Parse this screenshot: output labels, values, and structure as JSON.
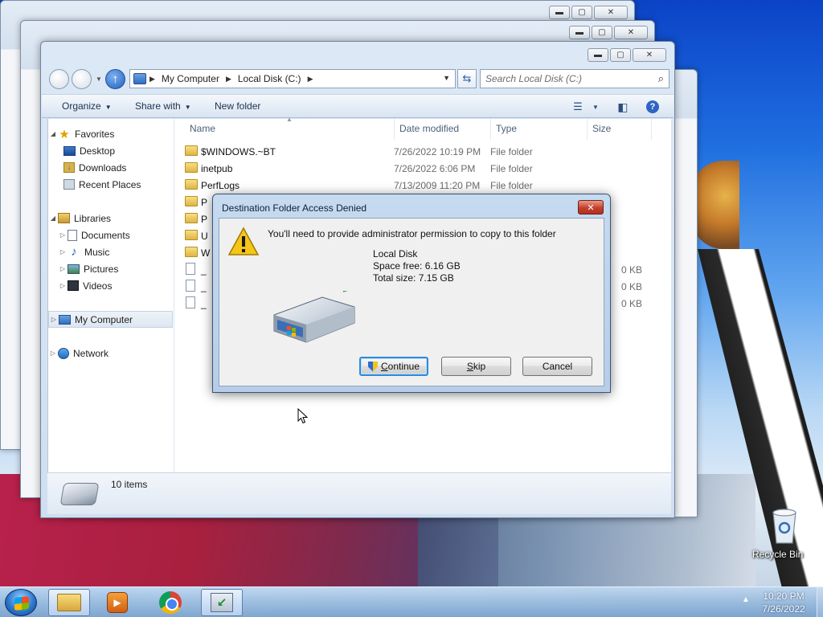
{
  "window": {
    "caption_buttons": {
      "minimize": "▬",
      "maximize": "▢",
      "close": "✕"
    },
    "address": {
      "segments": [
        "My Computer",
        "Local Disk (C:)"
      ]
    },
    "search_placeholder": "Search Local Disk (C:)",
    "toolbar": {
      "organize": "Organize",
      "share_with": "Share with",
      "new_folder": "New folder"
    },
    "nav": {
      "favorites": "Favorites",
      "desktop": "Desktop",
      "downloads": "Downloads",
      "recent_places": "Recent Places",
      "libraries": "Libraries",
      "documents": "Documents",
      "music": "Music",
      "pictures": "Pictures",
      "videos": "Videos",
      "my_computer": "My Computer",
      "network": "Network"
    },
    "columns": {
      "name": "Name",
      "date_modified": "Date modified",
      "type": "Type",
      "size": "Size"
    },
    "files": [
      {
        "name": "$WINDOWS.~BT",
        "date": "7/26/2022 10:19 PM",
        "type": "File folder",
        "size": ""
      },
      {
        "name": "inetpub",
        "date": "7/26/2022 6:06 PM",
        "type": "File folder",
        "size": ""
      },
      {
        "name": "PerfLogs",
        "date": "7/13/2009 11:20 PM",
        "type": "File folder",
        "size": ""
      },
      {
        "name": "P",
        "date": "",
        "type": "",
        "size": ""
      },
      {
        "name": "P",
        "date": "",
        "type": "",
        "size": ""
      },
      {
        "name": "U",
        "date": "",
        "type": "",
        "size": ""
      },
      {
        "name": "W",
        "date": "",
        "type": "",
        "size": ""
      },
      {
        "name": "_",
        "date": "",
        "type": "",
        "size": "0 KB"
      },
      {
        "name": "_",
        "date": "",
        "type": "",
        "size": "0 KB"
      },
      {
        "name": "_",
        "date": "",
        "type": "",
        "size": "0 KB"
      }
    ],
    "status": {
      "item_count": "10 items"
    }
  },
  "dialog": {
    "title": "Destination Folder Access Denied",
    "close": "✕",
    "message": "You'll need to provide administrator permission to copy to this folder",
    "drive_name": "Local Disk",
    "space_free": "Space free: 6.16 GB",
    "total_size": "Total size: 7.15 GB",
    "buttons": {
      "continue_pre": "",
      "continue_ul": "C",
      "continue_post": "ontinue",
      "skip_pre": "",
      "skip_ul": "S",
      "skip_post": "kip",
      "cancel": "Cancel"
    }
  },
  "desktop": {
    "recycle_bin": "Recycle Bin"
  },
  "taskbar": {
    "time": "10:20 PM",
    "date": "7/26/2022",
    "tray_arrow": "▲"
  },
  "colors": {
    "accent": "#2e8ad8",
    "dialog_close": "#c4402a",
    "selection": "#dde6f1"
  }
}
